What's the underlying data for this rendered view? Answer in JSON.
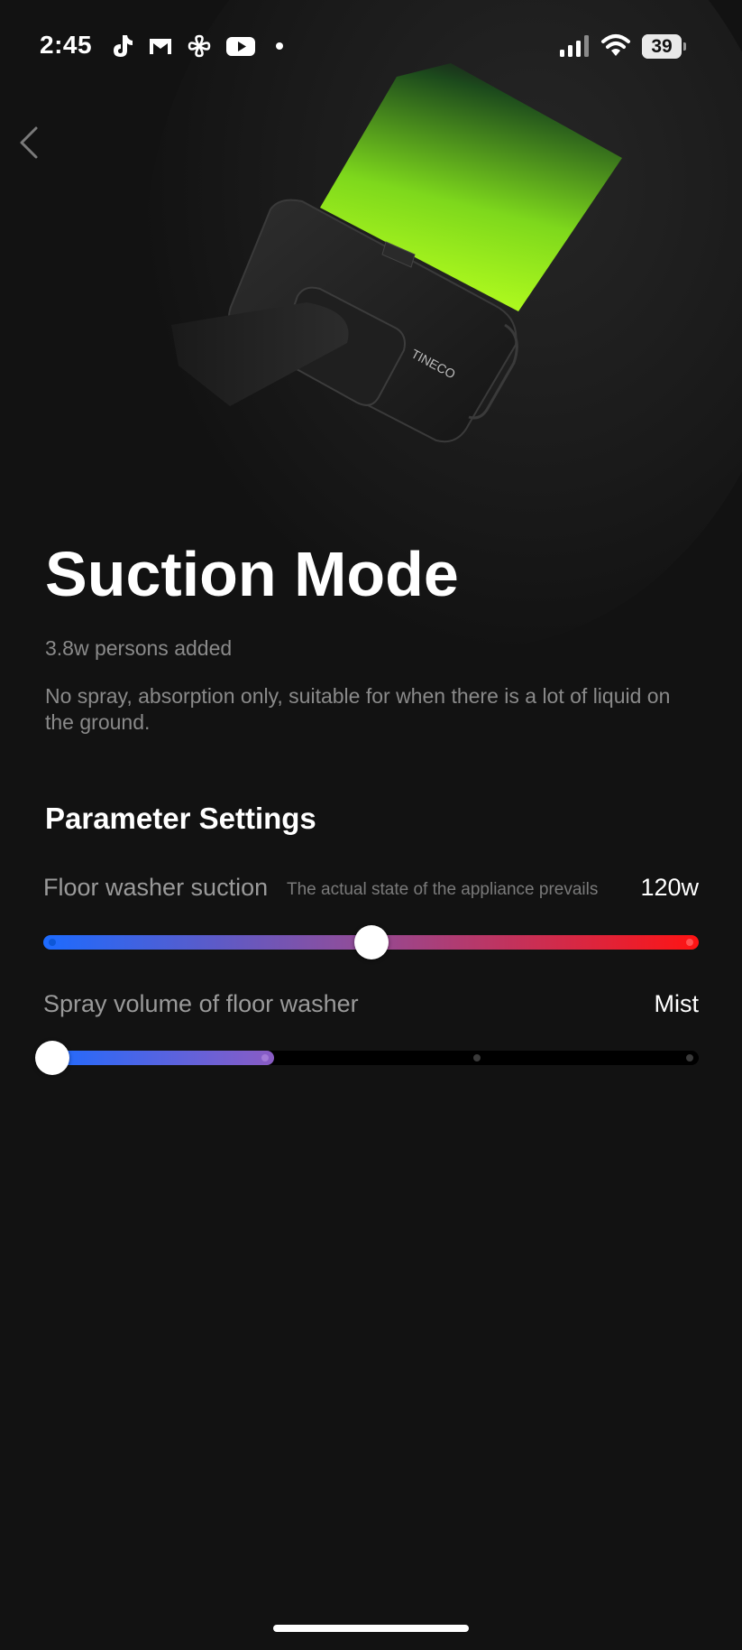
{
  "status_bar": {
    "time": "2:45",
    "battery_level": 39,
    "battery_text": "39",
    "apps": [
      "tiktok-icon",
      "mail-icon",
      "pinwheel-icon",
      "youtube-icon"
    ]
  },
  "hero": {
    "product_brand": "TINECO"
  },
  "mode": {
    "title": "Suction Mode",
    "users_added": "3.8w persons added",
    "description": "No spray, absorption only, suitable for when there is a lot of liquid on the ground."
  },
  "parameters": {
    "section_title": "Parameter Settings",
    "suction": {
      "label": "Floor washer suction",
      "note": "The actual state of the appliance prevails",
      "value": "120w",
      "level": 0.5,
      "colors": [
        "#1d6bff",
        "#ff1313"
      ]
    },
    "spray": {
      "label": "Spray volume of floor washer",
      "value": "Mist",
      "level": 0,
      "steps": 4,
      "colors": [
        "#1d6bff",
        "#8a5cc4"
      ]
    }
  },
  "colors": {
    "background": "#121212",
    "accent_green": "#aaff1e"
  }
}
